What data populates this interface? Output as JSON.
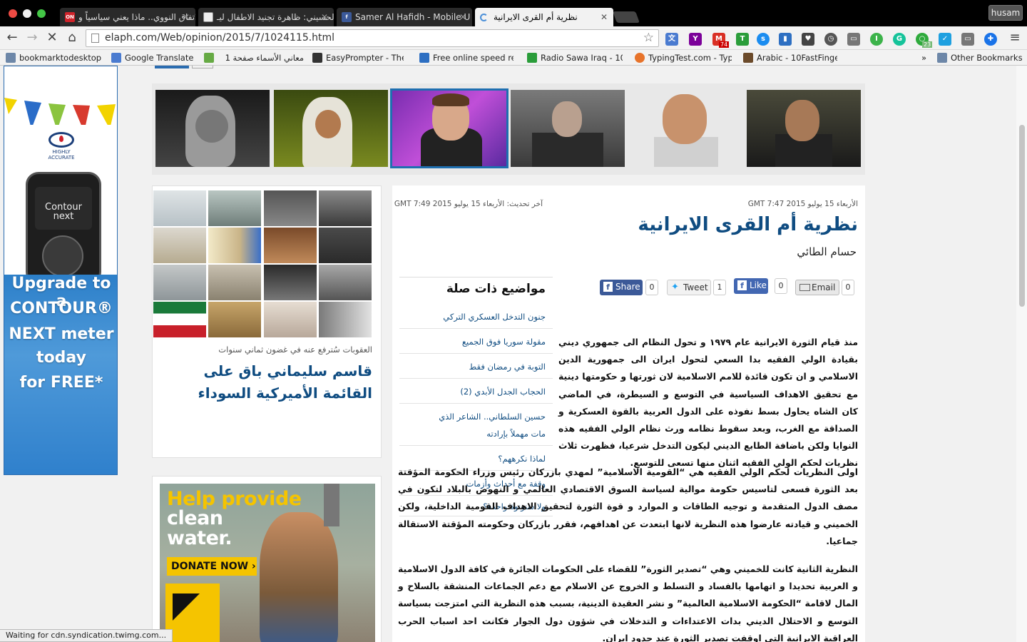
{
  "browser": {
    "tabs": [
      {
        "label": "الاتفاق النووي.. ماذا يعني سياسياً و",
        "favicon": "ON"
      },
      {
        "label": "الحسيني: ظاهرة تجنيد الاطفال ليـ",
        "favicon": ""
      },
      {
        "label": "Samer Al Hafidh - Mobile U",
        "favicon": "f"
      },
      {
        "label": "نظرية أم القرى الايرانية",
        "favicon": ""
      }
    ],
    "user": "husam",
    "url": "elaph.com/Web/opinion/2015/7/1024115.html",
    "extension_badges": {
      "gmail": "74",
      "green": "23"
    },
    "bookmarks": [
      "bookmarktodesktop",
      "Google Translate",
      "معاني الأسماء صفحة 1",
      "EasyPrompter - The",
      "Free online speed re",
      "Radio Sawa Iraq - 10",
      "TypingTest.com - Typ",
      "Arabic - 10FastFinge",
      "»",
      "Other Bookmarks"
    ],
    "status": "Waiting for cdn.syndication.twimg.com..."
  },
  "left_ad": {
    "brand": [
      "HIGHLY",
      "ACCURATE"
    ],
    "device_label": [
      "Contour",
      "next"
    ],
    "lines": [
      "Upgrade to a",
      "CONTOUR®",
      "NEXT meter",
      "today",
      "for FREE*"
    ]
  },
  "article": {
    "published": "الأربعاء 15 يوليو 2015 GMT 7:47",
    "updated": "آخر تحديث: الأربعاء 15 يوليو 2015 GMT 7:49",
    "title": "نظرية أم القرى الايرانية",
    "author": "حسام الطائي",
    "share": {
      "facebook": "Share",
      "facebook_count": "0",
      "tweet": "Tweet",
      "tweet_count": "1",
      "like": "Like",
      "like_count": "0",
      "email": "Email",
      "email_count": "0"
    },
    "paragraphs": [
      "منذ قيام الثورة الايرانية عام ١٩٧٩ و تحول النظام الى جمهوري ديني بقيادة الولي الفقيه بدا السعي لتحول ايران الى جمهورية الدين الاسلامي و ان تكون قائدة للامم الاسلامية لان ثورتها و حكومتها دينية مع تحقيق الاهداف السياسية في التوسع و السيطرة، في الماضي كان الشاه يحاول بسط نفوذه على الدول العربية بالقوة العسكرية و الصداقة مع الغرب، وبعد سقوط نظامه ورث نظام الولي الفقيه هذه النوايا ولكن باضافة الطابع الديني ليكون التدخل شرعيا، فظهرت ثلاث نظريات لحكم الولي الفقيه اثنان منها تسعى للتوسع.",
      "اولى النظريات لحكم الولي الفقيه هي “القومية الاسلامية” لمهدي بازركان رئيس وزراء الحكومة المؤقتة بعد الثورة فسعى لتاسيس حكومة موالية لسياسة السوق الاقتصادي العالمي و النهوض بالبلاد لتكون في مصف الدول المتقدمة و توجيه الطاقات و الموارد و قوة الثورة لتحقيق الاهداف القومية الداخلية، ولكن الخميني و قيادته عارضوا هذه النظرية لانها ابتعدت عن اهدافهم، فقرر بازركان وحكومته المؤقتة الاستقالة جماعيا.",
      "النظرية الثانية كانت للخميني وهي “تصدير الثورة” للقضاء على الحكومات الجائرة في كافة الدول الاسلامية و العربية تحديدا و اتهامها بالفساد و التسلط و الخروج عن الاسلام مع دعم الجماعات المنشقة بالسلاح و المال لاقامة “الحكومة الاسلامية العالمية” و نشر العقيدة الدينية، بسبب هذه النظرية التي امتزجت بسياسة التوسع و الاحتلال الديني بدات الاعتداءات و التدخلات في شؤون دول الجوار فكانت احد اسباب الحرب العراقية الايرانية التي اوقفت تصدير الثورة عند حدود ايران."
    ]
  },
  "related": {
    "heading": "مواضيع ذات صلة",
    "items": [
      "جنون التدخل العسكري التركي",
      "مقولة سوريا فوق الجميع",
      "التوبة في رمضان فقط",
      "الحجاب الجدل الأبدي (2)",
      "حسين السلطاني.. الشاعر الذي مات مهملاً بإرادته",
      "لماذا نكرههم؟",
      "وقفة مع أحداث وأزمات",
      "ولا سنونوة واحدة؟"
    ]
  },
  "gallery": {
    "caption": "العقوبات سُترفع عنه في غضون ثماني سنوات",
    "headline": "قاسم سليماني باق على القائمة الأميركية السوداء"
  },
  "irc_ad": {
    "line1": "Help provide",
    "line2": "clean water.",
    "cta": "DONATE NOW ›"
  }
}
